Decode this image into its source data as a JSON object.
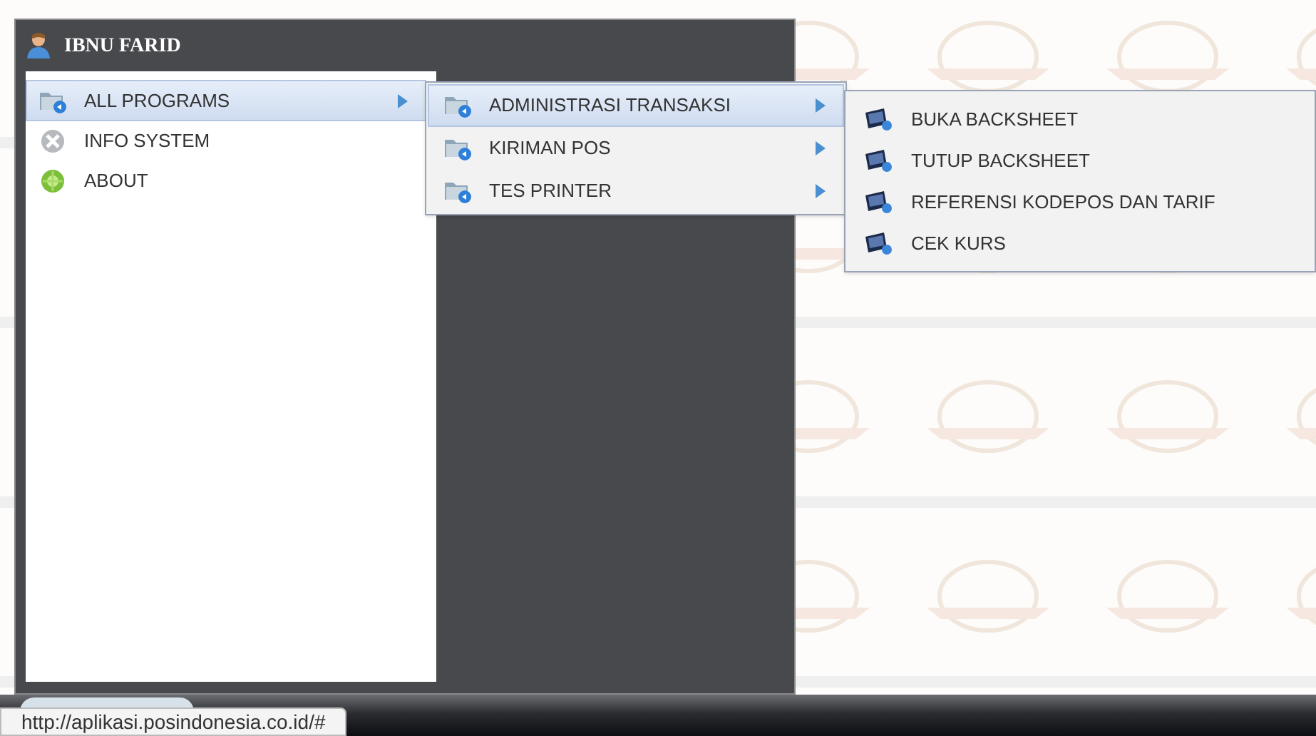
{
  "start_menu": {
    "user": "IBNU FARID",
    "items": [
      {
        "label": "ALL PROGRAMS",
        "kind": "programs",
        "selected": true,
        "has_submenu": true
      },
      {
        "label": "INFO SYSTEM",
        "kind": "info",
        "selected": false,
        "has_submenu": false
      },
      {
        "label": "ABOUT",
        "kind": "about",
        "selected": false,
        "has_submenu": false
      }
    ]
  },
  "submenu": {
    "items": [
      {
        "label": "ADMINISTRASI TRANSAKSI",
        "selected": true,
        "has_submenu": true
      },
      {
        "label": "KIRIMAN POS",
        "selected": false,
        "has_submenu": true
      },
      {
        "label": "TES PRINTER",
        "selected": false,
        "has_submenu": true
      }
    ]
  },
  "submenu_2": {
    "items": [
      {
        "label": "BUKA BACKSHEET",
        "selected": false
      },
      {
        "label": "TUTUP BACKSHEET",
        "selected": false
      },
      {
        "label": "REFERENSI KODEPOS DAN TARIF",
        "selected": false
      },
      {
        "label": "CEK KURS",
        "selected": false
      }
    ]
  },
  "status_tooltip": "http://aplikasi.posindonesia.co.id/#"
}
